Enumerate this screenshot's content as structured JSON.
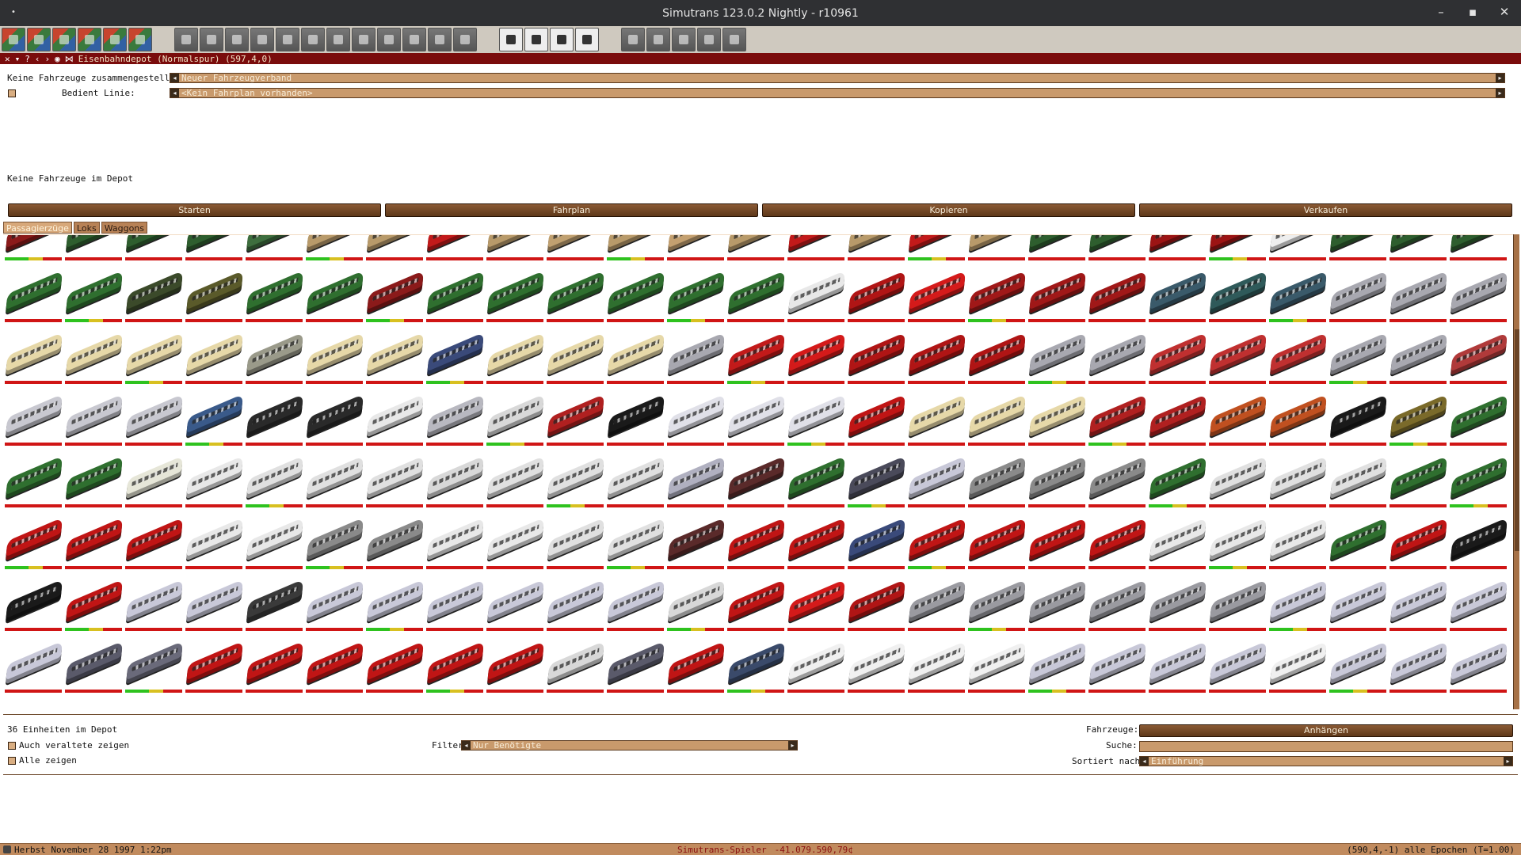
{
  "window": {
    "title": "Simutrans 123.0.2 Nightly - r10961",
    "menu_dot": "•",
    "min": "–",
    "max": "▪",
    "close": "✕"
  },
  "toolbar": {
    "groups": [
      {
        "name": "main-tools",
        "icons": [
          "tools-icon",
          "save-icon",
          "load-icon",
          "disk-icon",
          "map-icon",
          "minimap-icon"
        ]
      },
      {
        "name": "vehicle-tools",
        "icons": [
          "rail-icon",
          "road-icon",
          "ship-icon",
          "train-icon",
          "tram-icon",
          "monorail-icon",
          "airport-icon",
          "maglev-icon",
          "narrowgauge-icon",
          "depot-icon",
          "signal-icon",
          "powerline-icon"
        ]
      },
      {
        "name": "info-tools",
        "icons": [
          "list-icon",
          "chart-icon",
          "letter-icon",
          "help-icon"
        ]
      },
      {
        "name": "control-tools",
        "icons": [
          "camera-icon",
          "pause-icon",
          "fast-forward-icon",
          "info-icon",
          "settings-icon"
        ]
      }
    ]
  },
  "depot_window": {
    "title": "Eisenbahndepot (Normalspur) (597,4,0)",
    "icons": [
      "close-icon",
      "menu-icon",
      "help-icon",
      "prev-icon",
      "next-icon",
      "eye-icon",
      "pin-icon"
    ],
    "convoy_label": "Keine Fahrzeuge zusammengestellt",
    "convoy_value": "Neuer Fahrzeugverband",
    "line_label": "Bedient Linie:",
    "line_value": "<Kein Fahrplan vorhanden>",
    "depot_empty": "Keine Fahrzeuge im Depot",
    "buttons": {
      "start": "Starten",
      "schedule": "Fahrplan",
      "copy": "Kopieren",
      "sell": "Verkaufen"
    },
    "tabs": [
      {
        "label": "Passagierzüge",
        "active": true
      },
      {
        "label": "Loks",
        "active": false
      },
      {
        "label": "Waggons",
        "active": false
      }
    ],
    "units_in_depot": "36 Einheiten im Depot",
    "show_obsolete": "Auch veraltete zeigen",
    "show_all": "Alle zeigen",
    "filter_label": "Filter:",
    "filter_value": "Nur Benötigte",
    "vehicles_label": "Fahrzeuge:",
    "attach_button": "Anhängen",
    "search_label": "Suche:",
    "search_value": "",
    "sort_label": "Sortiert nach:",
    "sort_value": "Einführung",
    "vehicle_rows": [
      [
        "#8b1a1a",
        "#2e5e2e",
        "#2e5e2e",
        "#2e5e2e",
        "#3e6e3e",
        "#b89a6a",
        "#b89a6a",
        "#c21a1a",
        "#b89a6a",
        "#c0a070",
        "#b89a6a",
        "#c4a070",
        "#b89a6a",
        "#c21a1a",
        "#b89a6a",
        "#c21a1a",
        "#b89a6a",
        "#2e5e2e",
        "#2e5e2e",
        "#9c1414",
        "#9c1414",
        "#eeeeee",
        "#2e5e2e",
        "#2e5e2e",
        "#2e5e2e"
      ],
      [
        "#2f6f2f",
        "#2f6f2f",
        "#3b4a2a",
        "#5a5a2a",
        "#2f6f2f",
        "#2f6f2f",
        "#8b1a1a",
        "#2f6f2f",
        "#2f6f2f",
        "#2f6f2f",
        "#2f6f2f",
        "#2f6f2f",
        "#2f6f2f",
        "#e8e8e8",
        "#b01515",
        "#d41a1a",
        "#a01818",
        "#a01818",
        "#a01818",
        "#3a5a6a",
        "#2f5a5a",
        "#3a5a6a",
        "#a8a8b0",
        "#a8a8b0",
        "#a8a8b0"
      ],
      [
        "#e6d8a8",
        "#e6d8a8",
        "#e6d8a8",
        "#e6d8a8",
        "#9a9a8a",
        "#e6d8a8",
        "#e6d8a8",
        "#3a4a7a",
        "#e6d8a8",
        "#e6d8a8",
        "#e6d8a8",
        "#a8a8b0",
        "#c21a1a",
        "#d41a1a",
        "#b01515",
        "#b01515",
        "#b01515",
        "#a8a8b0",
        "#a8a8b0",
        "#c03030",
        "#c03030",
        "#c03030",
        "#a8a8b0",
        "#a8a8b0",
        "#b03a3a"
      ],
      [
        "#c8c8d0",
        "#c8c8d0",
        "#c8c8d0",
        "#3a5a8a",
        "#2a2a2a",
        "#2a2a2a",
        "#e8e8e8",
        "#b8b8c0",
        "#d8d8d8",
        "#b02020",
        "#1a1a1a",
        "#e0e0e8",
        "#e0e0e8",
        "#e0e0e8",
        "#c01515",
        "#e6d8a8",
        "#e6d8a8",
        "#e6d8a8",
        "#b02020",
        "#b02020",
        "#c05020",
        "#c05020",
        "#1a1a1a",
        "#7a6a2a",
        "#2f6f2f"
      ],
      [
        "#2f6f2f",
        "#2f6f2f",
        "#e6e6d8",
        "#e8e8e8",
        "#e0e0e0",
        "#e0e0e0",
        "#e0e0e0",
        "#d8d8d8",
        "#e0e0e0",
        "#e0e0e0",
        "#e0e0e0",
        "#b0b0c0",
        "#5a2a2a",
        "#2f6f2f",
        "#4a4a5a",
        "#c8c8d8",
        "#8a8a8a",
        "#8a8a8a",
        "#8a8a8a",
        "#2f6f2f",
        "#e0e0e0",
        "#e0e0e0",
        "#e0e0e0",
        "#2f6f2f",
        "#2f6f2f"
      ],
      [
        "#c01515",
        "#c01515",
        "#c01515",
        "#e8e8e8",
        "#e8e8e8",
        "#8a8a8a",
        "#8a8a8a",
        "#e8e8e8",
        "#e8e8e8",
        "#e0e0e0",
        "#e0e0e0",
        "#5a2a2a",
        "#c01515",
        "#c01515",
        "#3a4a7a",
        "#c01515",
        "#c01515",
        "#c01515",
        "#c01515",
        "#e8e8e8",
        "#e8e8e8",
        "#e8e8e8",
        "#2f6f2f",
        "#c01515",
        "#1a1a1a"
      ],
      [
        "#1a1a1a",
        "#c01515",
        "#c8c8d8",
        "#c8c8d8",
        "#3a3a3a",
        "#c8c8d8",
        "#c8c8d8",
        "#c8c8d8",
        "#c8c8d8",
        "#c8c8d8",
        "#c8c8d8",
        "#d8d8d8",
        "#c01515",
        "#d41a1a",
        "#b01515",
        "#9a9aa0",
        "#9a9aa0",
        "#9a9aa0",
        "#9a9aa0",
        "#9a9aa0",
        "#9a9aa0",
        "#c8c8d8",
        "#c8c8d8",
        "#c8c8d8",
        "#c8c8d8"
      ],
      [
        "#c8c8d8",
        "#5a5a6a",
        "#6a6a7a",
        "#c01515",
        "#c01515",
        "#c01515",
        "#c01515",
        "#c01515",
        "#c01515",
        "#d8d8d8",
        "#5a5a6a",
        "#c01515",
        "#3a4a6a",
        "#f0f0f0",
        "#f0f0f0",
        "#f0f0f0",
        "#f0f0f0",
        "#c8c8d8",
        "#c8c8d8",
        "#c8c8d8",
        "#c8c8d8",
        "#f0f0f0",
        "#c8c8d8",
        "#c8c8d8",
        "#c8c8d8"
      ]
    ]
  },
  "statusbar": {
    "date": "Herbst November 28 1997  1:22pm",
    "player": "Simutrans-Spieler",
    "money": "-41.079.590,79¢",
    "position": "(590,4,-1) alle Epochen (T=1.00)"
  }
}
